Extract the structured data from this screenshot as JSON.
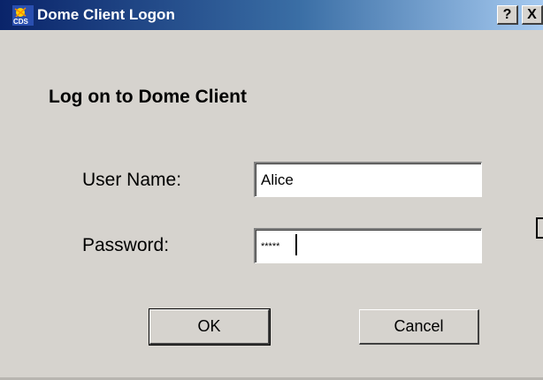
{
  "window": {
    "title": "Dome Client Logon",
    "help_button": "?",
    "close_button": "X",
    "icon": "cds-app-icon",
    "icon_text": "CDS"
  },
  "form": {
    "heading": "Log on to Dome Client",
    "username_label": "User Name:",
    "username_value": "Alice",
    "password_label": "Password:",
    "password_masked": "*****"
  },
  "buttons": {
    "ok_label": "OK",
    "cancel_label": "Cancel"
  },
  "colors": {
    "title_bar_start": "#0a246a",
    "title_bar_end": "#a6caf0",
    "dialog_face": "#d6d3ce"
  }
}
